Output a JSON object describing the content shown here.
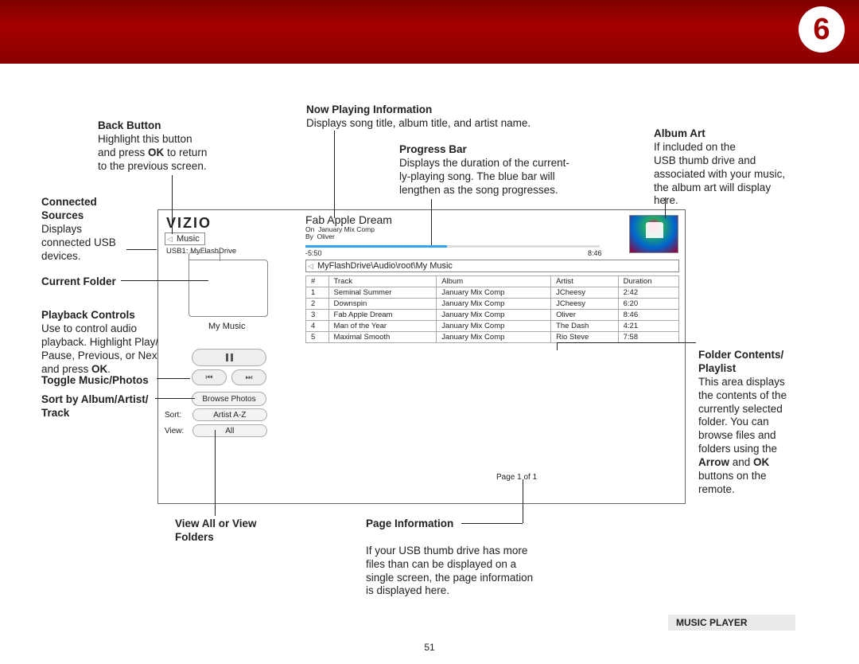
{
  "header": {
    "chapter": "6"
  },
  "footer": {
    "label": "MUSIC PLAYER",
    "pagenum": "51"
  },
  "ann": {
    "back": {
      "title": "Back Button",
      "body1": "Highlight this button",
      "body2": "and press ",
      "ok": "OK",
      "body3": " to return",
      "body4": "to the previous screen."
    },
    "sources": {
      "title1": "Connected",
      "title2": "Sources",
      "body1": "Displays",
      "body2": "connected USB",
      "body3": "devices."
    },
    "curfolder": {
      "title": "Current Folder"
    },
    "playback": {
      "title": "Playback Controls",
      "b1": "Use to control audio",
      "b2": "playback. Highlight Play/",
      "b3": "Pause, Previous, or Next",
      "b4": "and press ",
      "ok": "OK",
      "b5": "."
    },
    "toggle": {
      "title": "Toggle Music/Photos"
    },
    "sort": {
      "title1": "Sort by Album/Artist/",
      "title2": "Track"
    },
    "viewall": {
      "title1": "View All or View",
      "title2": "Folders"
    },
    "nowplay": {
      "title": "Now Playing Information",
      "body": "Displays song title, album title, and artist name."
    },
    "progress": {
      "title": "Progress Bar",
      "b1": "Displays the duration of the current-",
      "b2": "ly-playing song. The blue bar will",
      "b3": "lengthen as the song progresses."
    },
    "art": {
      "title": "Album Art",
      "b1": "If included on the",
      "b2": "USB thumb drive and",
      "b3": "associated with your music,",
      "b4": "the album art will display",
      "b5": "here."
    },
    "contents": {
      "title1": "Folder Contents/",
      "title2": "Playlist",
      "b1": "This area displays",
      "b2": "the contents of the",
      "b3": "currently selected",
      "b4": "folder. You can",
      "b5": "browse files and",
      "b6": "folders using the",
      "arrow": "Arrow",
      "and": " and ",
      "ok": "OK",
      "b7": "buttons on the",
      "b8": "remote."
    },
    "pageinfo": {
      "title": "Page Information",
      "b1": "If your USB thumb drive has more",
      "b2": "files than can be displayed on a",
      "b3": "single screen, the page information",
      "b4": "is displayed here."
    }
  },
  "ui": {
    "logo": "VIZIO",
    "back_label": "Music",
    "usb_label": "USB1: MyFlashDrive",
    "folder_label": "My Music",
    "browse_label": "Browse Photos",
    "sort_label": "Sort:",
    "sort_value": "Artist A-Z",
    "view_label": "View:",
    "view_value": "All",
    "now_title": "Fab Apple Dream",
    "now_on": "On",
    "now_album": "January Mix Comp",
    "now_by": "By",
    "now_artist": "Oliver",
    "t_elapsed": "-5:50",
    "t_total": "8:46",
    "path": "MyFlashDrive\\Audio\\root\\My Music",
    "cols": {
      "num": "#",
      "track": "Track",
      "album": "Album",
      "artist": "Artist",
      "dur": "Duration"
    },
    "rows": [
      {
        "n": "1",
        "track": "Seminal Summer",
        "album": "January Mix Comp",
        "artist": "JCheesy",
        "dur": "2:42"
      },
      {
        "n": "2",
        "track": "Downspin",
        "album": "January Mix Comp",
        "artist": "JCheesy",
        "dur": "6:20"
      },
      {
        "n": "3",
        "track": "Fab Apple Dream",
        "album": "January Mix Comp",
        "artist": "Oliver",
        "dur": "8:46"
      },
      {
        "n": "4",
        "track": "Man of the Year",
        "album": "January Mix Comp",
        "artist": "The Dash",
        "dur": "4:21"
      },
      {
        "n": "5",
        "track": "Maximal Smooth",
        "album": "January Mix Comp",
        "artist": "Rio Steve",
        "dur": "7:58"
      }
    ],
    "pageinfo": "Page 1 of 1"
  }
}
